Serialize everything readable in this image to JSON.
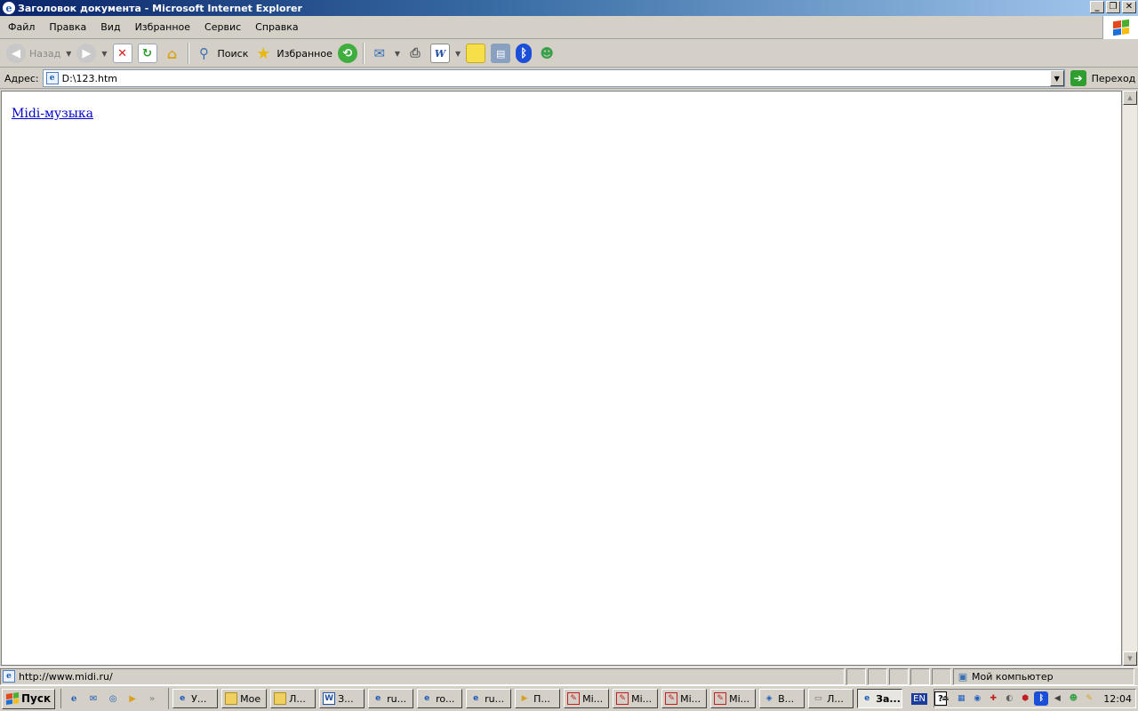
{
  "window": {
    "title": "Заголовок документа - Microsoft Internet Explorer",
    "minimize": "_",
    "restore": "❐",
    "close": "✕"
  },
  "menu": [
    "Файл",
    "Правка",
    "Вид",
    "Избранное",
    "Сервис",
    "Справка"
  ],
  "toolbar": {
    "back_label": "Назад",
    "search_label": "Поиск",
    "favorites_label": "Избранное"
  },
  "address": {
    "label": "Адрес:",
    "value": "D:\\123.htm",
    "go_label": "Переход"
  },
  "page": {
    "link_text": "Midi-музыка"
  },
  "status": {
    "text": "http://www.midi.ru/",
    "zone": "Мой компьютер"
  },
  "taskbar": {
    "start_label": "Пуск",
    "tasks": [
      "У...",
      "Мое",
      "Л...",
      "З...",
      "ru...",
      "ro...",
      "ru...",
      "П...",
      "Mi...",
      "Mi...",
      "Mi...",
      "Mi...",
      "В...",
      "Л...",
      "За..."
    ],
    "active_task": "За...",
    "lang": "EN",
    "help": "?",
    "clock": "12:04"
  },
  "colors": {
    "title_start": "#0a246a",
    "title_end": "#a6caf0",
    "link": "#0000cc"
  }
}
